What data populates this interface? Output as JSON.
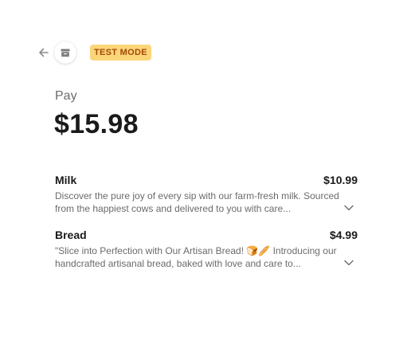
{
  "header": {
    "back_icon": "arrow-left-icon",
    "store_icon": "store-icon",
    "test_badge": "TEST MODE"
  },
  "payment": {
    "label": "Pay",
    "amount": "$15.98"
  },
  "items": [
    {
      "name": "Milk",
      "price": "$10.99",
      "description": "Discover the pure joy of every sip with our farm-fresh milk. Sourced from the happiest cows and delivered to you with care...",
      "expand_icon": "chevron-down-icon"
    },
    {
      "name": "Bread",
      "price": "$4.99",
      "description": "\"Slice into Perfection with Our Artisan Bread! 🍞🥖 Introducing our handcrafted artisanal bread, baked with love and care to...",
      "expand_icon": "chevron-down-icon"
    }
  ],
  "colors": {
    "badge_bg": "#fcd579",
    "badge_text": "#a04a08",
    "text_primary": "#1a1a1a",
    "text_secondary": "#6b6b6b"
  }
}
